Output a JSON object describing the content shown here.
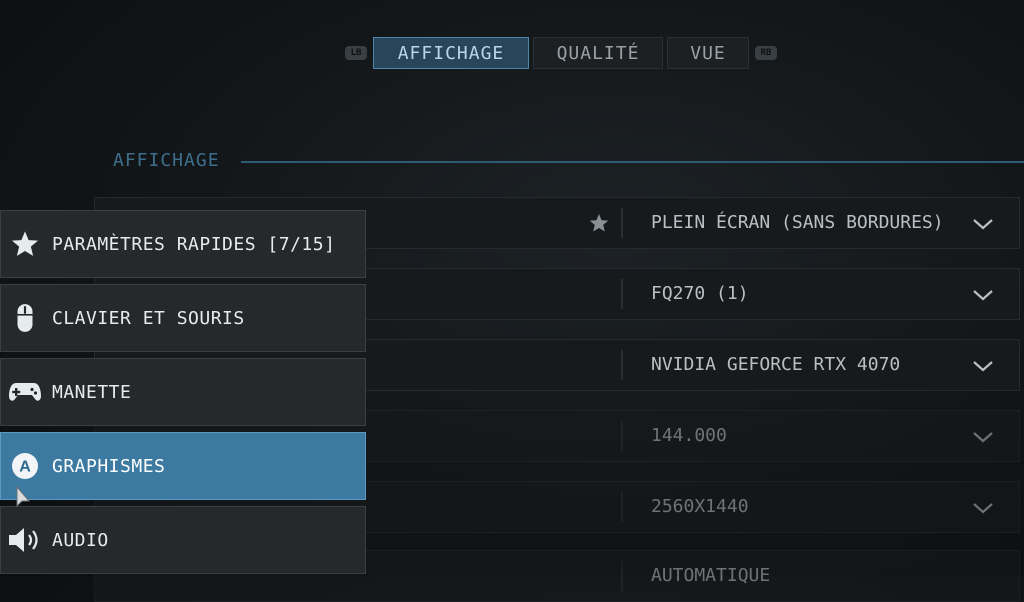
{
  "tabs": {
    "left_hint": "LB",
    "right_hint": "RB",
    "items": [
      {
        "label": "AFFICHAGE",
        "active": true
      },
      {
        "label": "QUALITÉ",
        "active": false
      },
      {
        "label": "VUE",
        "active": false
      }
    ]
  },
  "section": {
    "title": "AFFICHAGE"
  },
  "settings": [
    {
      "label": "",
      "value": "PLEIN ÉCRAN (SANS BORDURES)",
      "favorite_icon": "star-icon"
    },
    {
      "label": "",
      "value": "FQ270 (1)"
    },
    {
      "label": "",
      "value": "NVIDIA GEFORCE RTX 4070"
    },
    {
      "label": "",
      "value": "144.000"
    },
    {
      "label": "",
      "value": "2560X1440"
    },
    {
      "label": "",
      "value": "AUTOMATIQUE"
    }
  ],
  "menu": [
    {
      "label": "PARAMÈTRES RAPIDES [7/15]",
      "icon": "star-icon",
      "active": false
    },
    {
      "label": "CLAVIER ET SOURIS",
      "icon": "mouse-icon",
      "active": false
    },
    {
      "label": "MANETTE",
      "icon": "gamepad-icon",
      "active": false
    },
    {
      "label": "GRAPHISMES",
      "icon": "a-button-icon",
      "active": true
    },
    {
      "label": "AUDIO",
      "icon": "speaker-icon",
      "active": false
    }
  ],
  "colors": {
    "accent": "#3d7aa2",
    "tab_active": "#27465a",
    "section_title": "#3d6e8c"
  }
}
